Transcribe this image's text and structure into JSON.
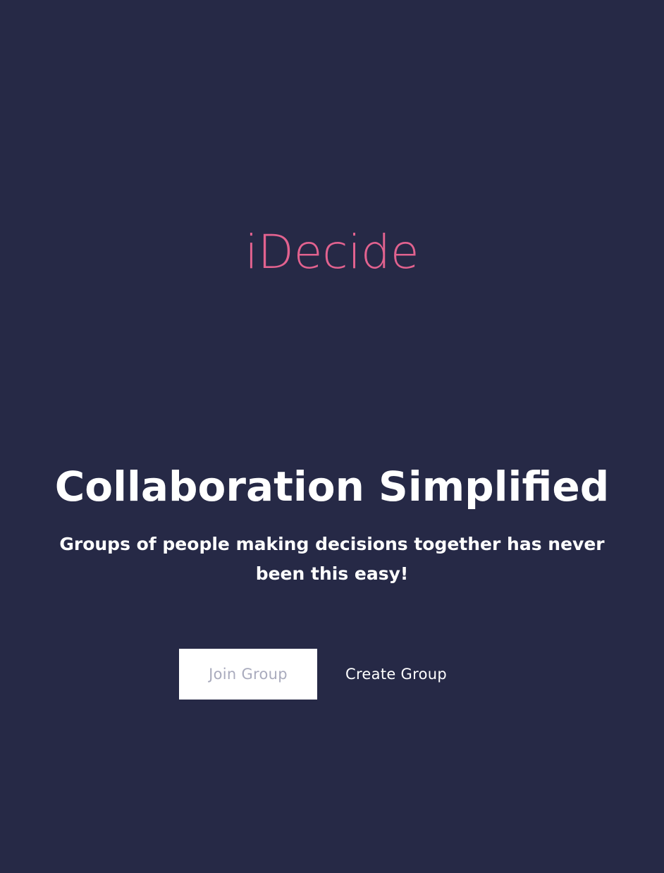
{
  "app": {
    "logo_text": "iDecide"
  },
  "hero": {
    "title": "Collaboration Simplified",
    "subtitle": "Groups of people making decisions together has never been this easy!"
  },
  "actions": {
    "join_label": "Join Group",
    "create_label": "Create Group"
  },
  "colors": {
    "background": "#262946",
    "brand_pink": "#e2628f",
    "text_white": "#ffffff",
    "muted_button_text": "#a9abbd"
  }
}
